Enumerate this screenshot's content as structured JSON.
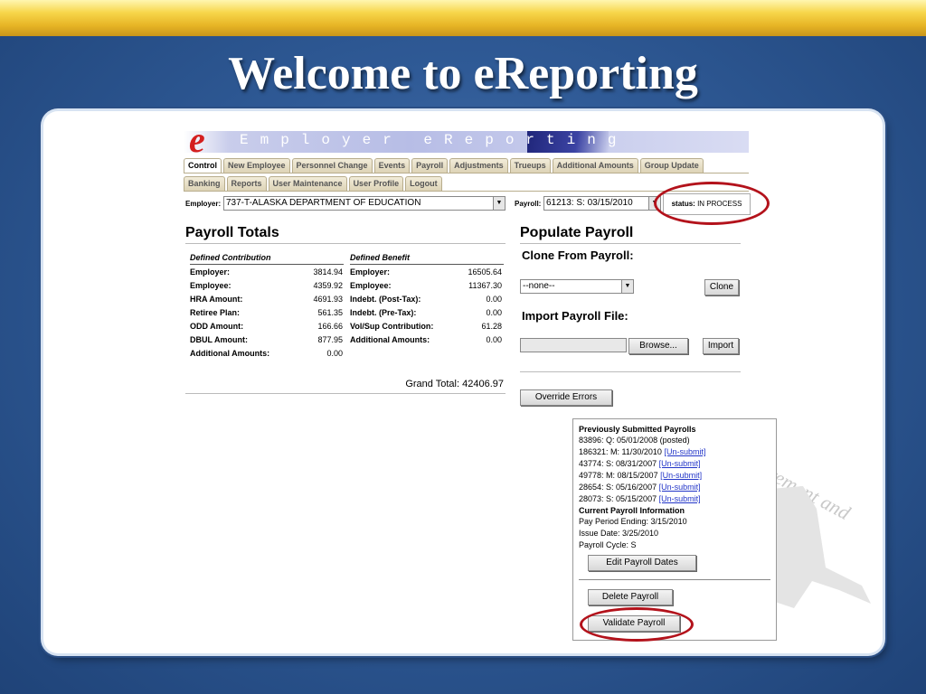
{
  "slide": {
    "title": "Welcome to eReporting"
  },
  "banner": {
    "logo_letter": "e",
    "text": "Employer eReporting"
  },
  "tabs_row1": [
    "Control",
    "New Employee",
    "Personnel Change",
    "Events",
    "Payroll",
    "Adjustments",
    "Trueups",
    "Additional Amounts",
    "Group Update"
  ],
  "tabs_row2": [
    "Banking",
    "Reports",
    "User Maintenance",
    "User Profile",
    "Logout"
  ],
  "employer": {
    "label": "Employer:",
    "value": "737-T-ALASKA DEPARTMENT OF EDUCATION"
  },
  "payroll_select": {
    "label": "Payroll:",
    "value": "61213: S: 03/15/2010"
  },
  "status": {
    "label": "status:",
    "value": "IN PROCESS"
  },
  "totals": {
    "title": "Payroll Totals",
    "dc_header": "Defined Contribution",
    "db_header": "Defined Benefit",
    "dc_rows": [
      {
        "label": "Employer:",
        "value": "3814.94"
      },
      {
        "label": "Employee:",
        "value": "4359.92"
      },
      {
        "label": "HRA Amount:",
        "value": "4691.93"
      },
      {
        "label": "Retiree Plan:",
        "value": "561.35"
      },
      {
        "label": "ODD Amount:",
        "value": "166.66"
      },
      {
        "label": "DBUL Amount:",
        "value": "877.95"
      },
      {
        "label": "Additional Amounts:",
        "value": "0.00"
      }
    ],
    "db_rows": [
      {
        "label": "Employer:",
        "value": "16505.64"
      },
      {
        "label": "Employee:",
        "value": "11367.30"
      },
      {
        "label": "Indebt. (Post-Tax):",
        "value": "0.00"
      },
      {
        "label": "Indebt. (Pre-Tax):",
        "value": "0.00"
      },
      {
        "label": "Vol/Sup Contribution:",
        "value": "61.28"
      },
      {
        "label": "Additional Amounts:",
        "value": "0.00"
      }
    ],
    "grand_total": "Grand Total: 42406.97"
  },
  "populate": {
    "title": "Populate Payroll",
    "clone_title": "Clone From Payroll:",
    "clone_select": "--none--",
    "clone_button": "Clone",
    "import_title": "Import Payroll File:",
    "browse_button": "Browse...",
    "import_button": "Import",
    "override_button": "Override Errors"
  },
  "previous": {
    "title": "Previously Submitted Payrolls",
    "posted": "83896: Q: 05/01/2008 (posted)",
    "unsubmit_label": "[Un-submit]",
    "items": [
      "186321: M: 11/30/2010",
      "43774: S: 08/31/2007",
      "49778: M: 08/15/2007",
      "28654: S: 05/16/2007",
      "28073: S: 05/15/2007"
    ],
    "current_title": "Current Payroll Information",
    "pay_period": "Pay Period Ending: 3/15/2010",
    "issue_date": "Issue Date: 3/25/2010",
    "cycle": "Payroll Cycle: S",
    "edit_button": "Edit Payroll Dates",
    "delete_button": "Delete Payroll",
    "validate_button": "Validate Payroll"
  },
  "watermark": {
    "text": "Retirement and Benefits"
  },
  "colors": {
    "highlight_oval": "#b3121b",
    "slide_bg": "#2f5a96",
    "gold_bar": "#e7b526"
  }
}
